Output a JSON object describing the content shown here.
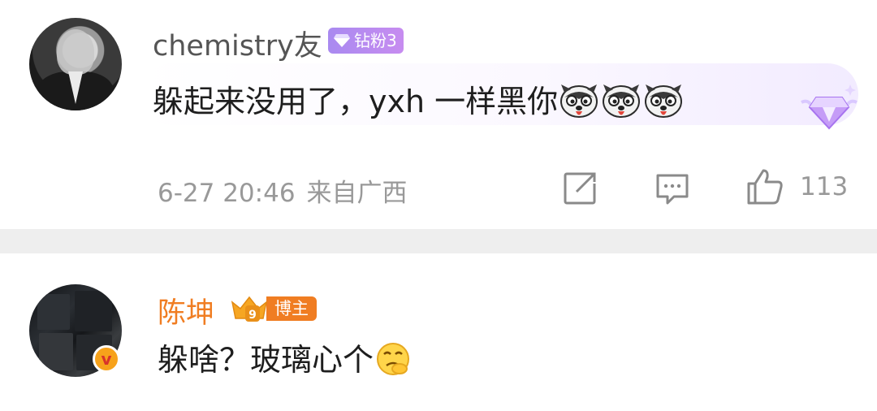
{
  "comments": [
    {
      "username": "chemistry友",
      "badge": "钻粉3",
      "text": "躲起来没用了，yxh 一样黑你",
      "emoji_count": 3,
      "emoji_icon": "husky-emoji-icon",
      "timestamp": "6-27 20:46",
      "location": "来自广西",
      "likes": "113",
      "colors": {
        "username": "#555555",
        "badge": "#b48cf2"
      }
    },
    {
      "username": "陈坤",
      "badge": "博主",
      "text": "躲啥？玻璃心个",
      "emoji_icon": "smirk-emoji-icon",
      "verified_icon": "v",
      "colors": {
        "username": "#f07d22",
        "badge": "#f07d22"
      }
    }
  ]
}
